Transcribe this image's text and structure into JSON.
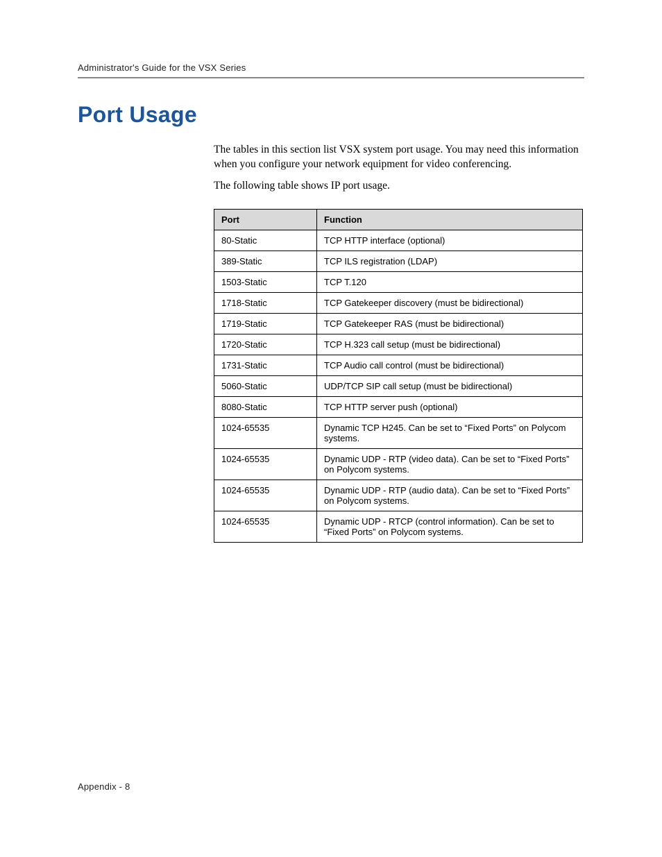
{
  "header": {
    "running_head": "Administrator's Guide for the VSX Series"
  },
  "title": "Port Usage",
  "intro": {
    "p1": "The tables in this section list VSX system port usage. You may need this information when you configure your network equipment for video conferencing.",
    "p2": "The following table shows IP port usage."
  },
  "table": {
    "columns": {
      "port": "Port",
      "function": "Function"
    },
    "rows": [
      {
        "port": "80-Static",
        "function": "TCP HTTP interface (optional)"
      },
      {
        "port": "389-Static",
        "function": "TCP ILS registration (LDAP)"
      },
      {
        "port": "1503-Static",
        "function": "TCP T.120"
      },
      {
        "port": "1718-Static",
        "function": "TCP Gatekeeper discovery (must be bidirectional)"
      },
      {
        "port": "1719-Static",
        "function": "TCP Gatekeeper RAS (must be bidirectional)"
      },
      {
        "port": "1720-Static",
        "function": "TCP H.323 call setup (must be bidirectional)"
      },
      {
        "port": "1731-Static",
        "function": "TCP Audio call control (must be bidirectional)"
      },
      {
        "port": "5060-Static",
        "function": "UDP/TCP SIP call setup (must be bidirectional)"
      },
      {
        "port": "8080-Static",
        "function": "TCP HTTP server push (optional)"
      },
      {
        "port": "1024-65535",
        "function": "Dynamic TCP H245. Can be set to “Fixed Ports” on Polycom systems."
      },
      {
        "port": "1024-65535",
        "function": "Dynamic UDP - RTP (video data). Can be set to “Fixed Ports” on Polycom systems."
      },
      {
        "port": "1024-65535",
        "function": "Dynamic UDP - RTP (audio data). Can be set to “Fixed Ports” on Polycom systems."
      },
      {
        "port": "1024-65535",
        "function": "Dynamic UDP - RTCP (control information). Can be set to “Fixed Ports” on Polycom systems."
      }
    ]
  },
  "footer": {
    "text": "Appendix - 8"
  }
}
